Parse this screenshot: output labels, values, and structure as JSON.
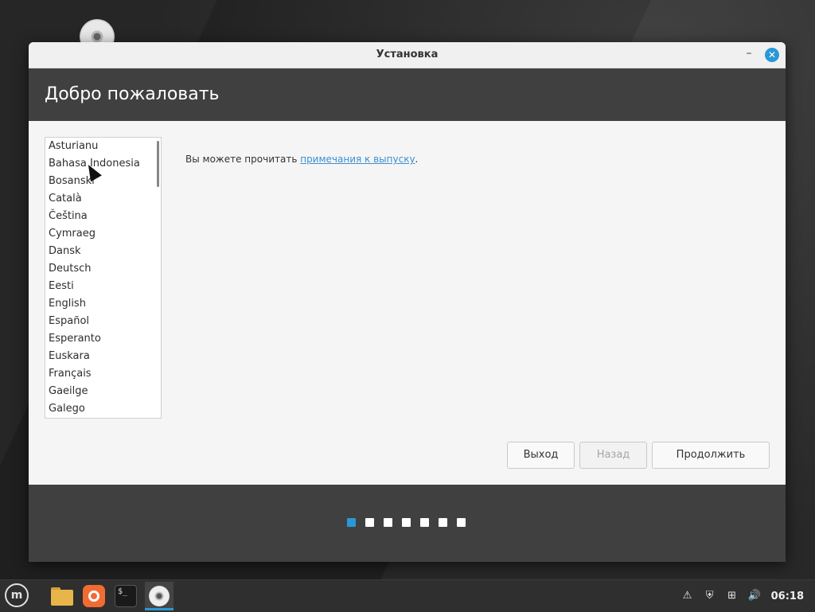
{
  "window": {
    "title": "Установка",
    "minimize_glyph": "–",
    "close_glyph": "✕"
  },
  "header": {
    "title": "Добро пожаловать"
  },
  "languages": [
    "Asturianu",
    "Bahasa Indonesia",
    "Bosanski",
    "Català",
    "Čeština",
    "Cymraeg",
    "Dansk",
    "Deutsch",
    "Eesti",
    "English",
    "Español",
    "Esperanto",
    "Euskara",
    "Français",
    "Gaeilge",
    "Galego"
  ],
  "release": {
    "prefix": "Вы можете прочитать ",
    "link": "примечания к выпуску",
    "suffix": "."
  },
  "buttons": {
    "quit": "Выход",
    "back": "Назад",
    "continue": "Продолжить"
  },
  "progress": {
    "total_steps": 7,
    "current_step": 1
  },
  "taskbar": {
    "menu_glyph": "m",
    "terminal_glyph": "$_",
    "tray_icons": [
      "update-icon",
      "shield-icon",
      "network-icon",
      "volume-icon"
    ],
    "clock": "06:18"
  },
  "colors": {
    "accent": "#2a98d6",
    "header_bg": "#404040",
    "link": "#3d8fd1"
  }
}
